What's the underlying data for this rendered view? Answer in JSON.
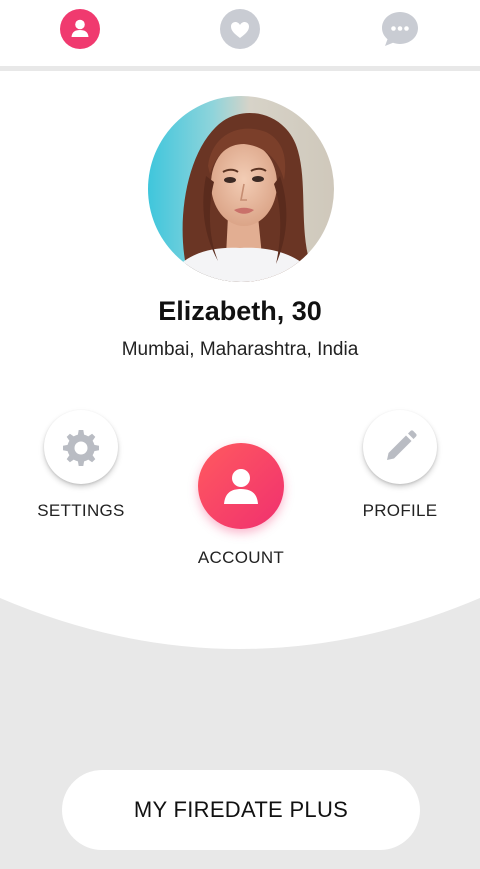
{
  "top_tabs": [
    {
      "name": "account",
      "icon": "person-icon",
      "active": true
    },
    {
      "name": "likes",
      "icon": "heart-icon",
      "active": false
    },
    {
      "name": "messages",
      "icon": "chat-bubble-icon",
      "active": false
    }
  ],
  "colors": {
    "accent": "#f03a6f",
    "inactive_icon": "#c9ccd3",
    "bottom_background": "#e8e8e8"
  },
  "profile": {
    "name": "Elizabeth, 30",
    "location": "Mumbai, Maharashtra, India"
  },
  "actions": {
    "settings_label": "SETTINGS",
    "account_label": "ACCOUNT",
    "profile_label": "PROFILE"
  },
  "subscription": {
    "label": "MY FIREDATE PLUS"
  }
}
